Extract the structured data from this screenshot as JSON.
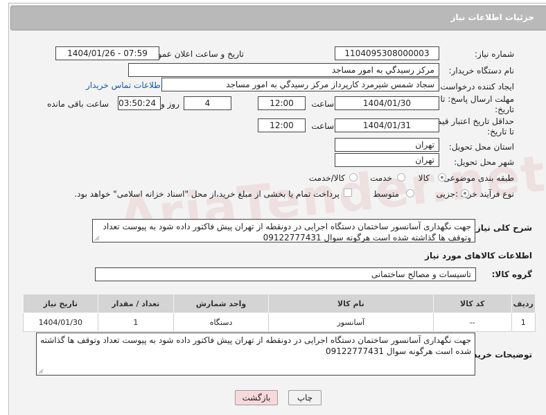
{
  "header": {
    "title": "جزئیات اطلاعات نیاز"
  },
  "fields": {
    "need_number_label": "شماره نیاز:",
    "need_number": "1104095308000003",
    "announce_label": "تاریخ و ساعت اعلان عمومی:",
    "announce_value": "1404/01/26 - 07:59",
    "buyer_org_label": "نام دستگاه خریدار:",
    "buyer_org": "مرکز رسیدگي به امور مساجد",
    "creator_label": "ایجاد کننده درخواست:",
    "creator": "سجاد شمس شیرمرد کارپرداز مرکز رسیدگي به امور مساجد",
    "contact_link": "اطلاعات تماس خریدار",
    "deadline_label_1": "مهلت ارسال پاسخ: تا",
    "deadline_label_2": "تاریخ:",
    "deadline_date": "1404/01/30",
    "time_label": "ساعت",
    "deadline_time": "12:00",
    "days_value": "4",
    "days_label": "روز و",
    "remaining_value": "03:50:24",
    "remaining_label": "ساعت باقی مانده",
    "min_price_label_1": "حداقل تاریخ اعتبار قیمت:",
    "min_price_label_2": "تا تاریخ:",
    "min_price_date": "1404/01/31",
    "min_price_time": "12:00",
    "province_label": "استان محل تحویل:",
    "province": "تهران",
    "city_label": "شهر محل تحویل:",
    "city": "تهران",
    "category_label": "طبقه بندی موضوعی:",
    "category_options": [
      "کالا",
      "خدمت",
      "کالا/خدمت"
    ],
    "process_label": "نوع فرآیند خرید :",
    "process_options": [
      "جزیی",
      "متوسط"
    ],
    "payment_note": "پرداخت تمام یا بخشی از مبلغ خرید،از محل \"اسناد خزانه اسلامی\" خواهد بود."
  },
  "description": {
    "label": "شرح کلی نیاز:",
    "text": "جهت نگهداری آسانسور ساختمان دستگاه اجرایی در دونقطه از تهران پیش فاکتور داده شود به پیوست تعداد وتوقف ها گذاشته شده است هرگونه سوال 09122777431"
  },
  "goods": {
    "section_title": "اطلاعات کالاهای مورد نیاز",
    "group_label": "گروه کالا:",
    "group_value": "تاسیسات و مصالح ساختمانی",
    "columns": [
      "ردیف",
      "کد کالا",
      "نام کالا",
      "واحد شمارش",
      "تعداد / مقدار",
      "تاریخ نیاز"
    ],
    "rows": [
      [
        "1",
        "--",
        "آسانسور",
        "دستگاه",
        "1",
        "1404/01/30"
      ]
    ]
  },
  "buyer_notes": {
    "label": "توضیحات خریدار:",
    "text": "جهت نگهداری آسانسور ساختمان دستگاه اجرایی در دونقطه از تهران پیش فاکتور داده شود به پیوست تعداد وتوقف ها گذاشته شده است هرگونه سوال 09122777431"
  },
  "buttons": {
    "print": "چاپ",
    "back": "بازگشت"
  },
  "watermark": "AriaTender.net",
  "colors": {
    "header_bg": "#b9b9b9",
    "link": "#1a5aa0",
    "back_btn_bg": "#f7d9dc"
  }
}
